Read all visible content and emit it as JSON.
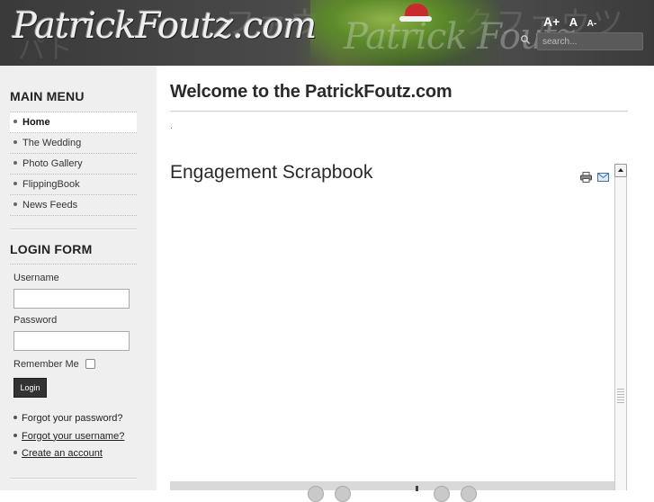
{
  "header": {
    "logo_text": "PatrickFoutz.com",
    "font_size_controls": {
      "increase": "A+",
      "reset": "A",
      "decrease": "A-"
    },
    "search": {
      "placeholder": "search..."
    }
  },
  "sidebar": {
    "main_menu_title": "MAIN MENU",
    "menu_items": [
      {
        "label": "Home",
        "active": true
      },
      {
        "label": "The Wedding",
        "active": false
      },
      {
        "label": "Photo Gallery",
        "active": false
      },
      {
        "label": "FlippingBook",
        "active": false
      },
      {
        "label": "News Feeds",
        "active": false
      }
    ],
    "login_form": {
      "title": "LOGIN FORM",
      "username_label": "Username",
      "password_label": "Password",
      "remember_label": "Remember Me",
      "remember_checked": false,
      "login_button": "Login",
      "links": [
        {
          "label": "Forgot your password?",
          "underlined": false
        },
        {
          "label": "Forgot your username?",
          "underlined": true
        },
        {
          "label": "Create an account",
          "underlined": true
        }
      ]
    }
  },
  "main": {
    "page_title": "Welcome to the PatrickFoutz.com",
    "intro_text": ".",
    "article_title": "Engagement Scrapbook",
    "icons": [
      "print-icon",
      "email-icon"
    ]
  },
  "colors": {
    "header_bg": "#3f3f3f",
    "sidebar_bg": "#efefef",
    "button_bg": "#333333"
  }
}
